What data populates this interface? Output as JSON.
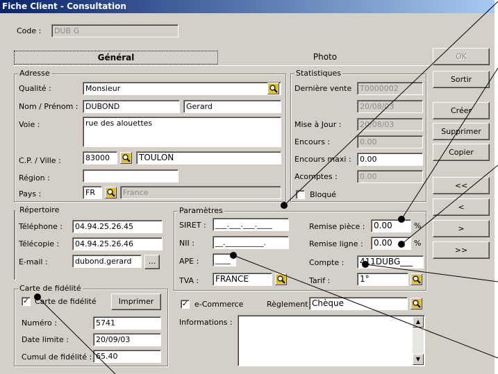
{
  "window": {
    "title": "Fiche Client - Consultation"
  },
  "code": {
    "label": "Code :",
    "value": "DUB G"
  },
  "tabs": [
    {
      "label": "Général"
    },
    {
      "label": "Photo"
    }
  ],
  "adresse": {
    "title": "Adresse",
    "qualite_label": "Qualité :",
    "qualite": "Monsieur",
    "nom_label": "Nom / Prénom :",
    "nom": "DUBOND",
    "prenom": "Gerard",
    "voie_label": "Voie :",
    "voie": "rue des alouettes",
    "cp_label": "C.P. / Ville :",
    "cp": "83000",
    "ville": "TOULON",
    "region_label": "Région :",
    "region": "",
    "pays_label": "Pays :",
    "pays_code": "FR",
    "pays": "France"
  },
  "statistiques": {
    "title": "Statistiques",
    "derniere_vente_label": "Dernière vente",
    "derniere_vente": "T0000002",
    "derniere_vente_date": "20/08/03",
    "maj_label": "Mise à Jour :",
    "maj": "20/08/03",
    "encours_label": "Encours :",
    "encours": "0.00",
    "encours_maxi_label": "Encours maxi :",
    "encours_maxi": "0.00",
    "acomptes_label": "Acomptes :",
    "acomptes": "0.00",
    "bloque_label": "Bloqué"
  },
  "repertoire": {
    "title": "Répertoire",
    "tel_label": "Téléphone :",
    "tel": "04.94.25.26.45",
    "fax_label": "Télécopie :",
    "fax": "04.94.25.26.46",
    "email_label": "E-mail :",
    "email": "dubond.gerard",
    "email_btn": "..."
  },
  "parametres": {
    "title": "Paramètres",
    "siret_label": "SIRET :",
    "siret": "___.___.___.____",
    "nii_label": "NII :",
    "nii": "__.__________.",
    "ape_label": "APE :",
    "ape": "____",
    "tva_label": "TVA :",
    "tva": "FRANCE",
    "remise_piece_label": "Remise pièce :",
    "remise_piece": "0.00",
    "remise_ligne_label": "Remise ligne :",
    "remise_ligne": "0.00",
    "pct": "%",
    "compte_label": "Compte :",
    "compte": "411DUBG___",
    "tarif_label": "Tarif :",
    "tarif": "1°"
  },
  "fidelite": {
    "title": "Carte de fidélité",
    "carte_label": "Carte de fidélité",
    "imprimer": "Imprimer",
    "numero_label": "Numéro :",
    "numero": "5741",
    "date_label": "Date limite :",
    "date": "20/09/03",
    "cumul_label": "Cumul de fidélité :",
    "cumul": "65.40"
  },
  "ecommerce": {
    "label": "e-Commerce",
    "reglement_label": "Règlement :",
    "reglement": "Chèque",
    "informations_label": "Informations :"
  },
  "buttons": {
    "ok": "OK",
    "sortir": "Sortir",
    "creer": "Créer",
    "supprimer": "Supprimer",
    "copier": "Copier",
    "first": "<<",
    "prev": "<",
    "next": ">",
    "last": ">>"
  }
}
